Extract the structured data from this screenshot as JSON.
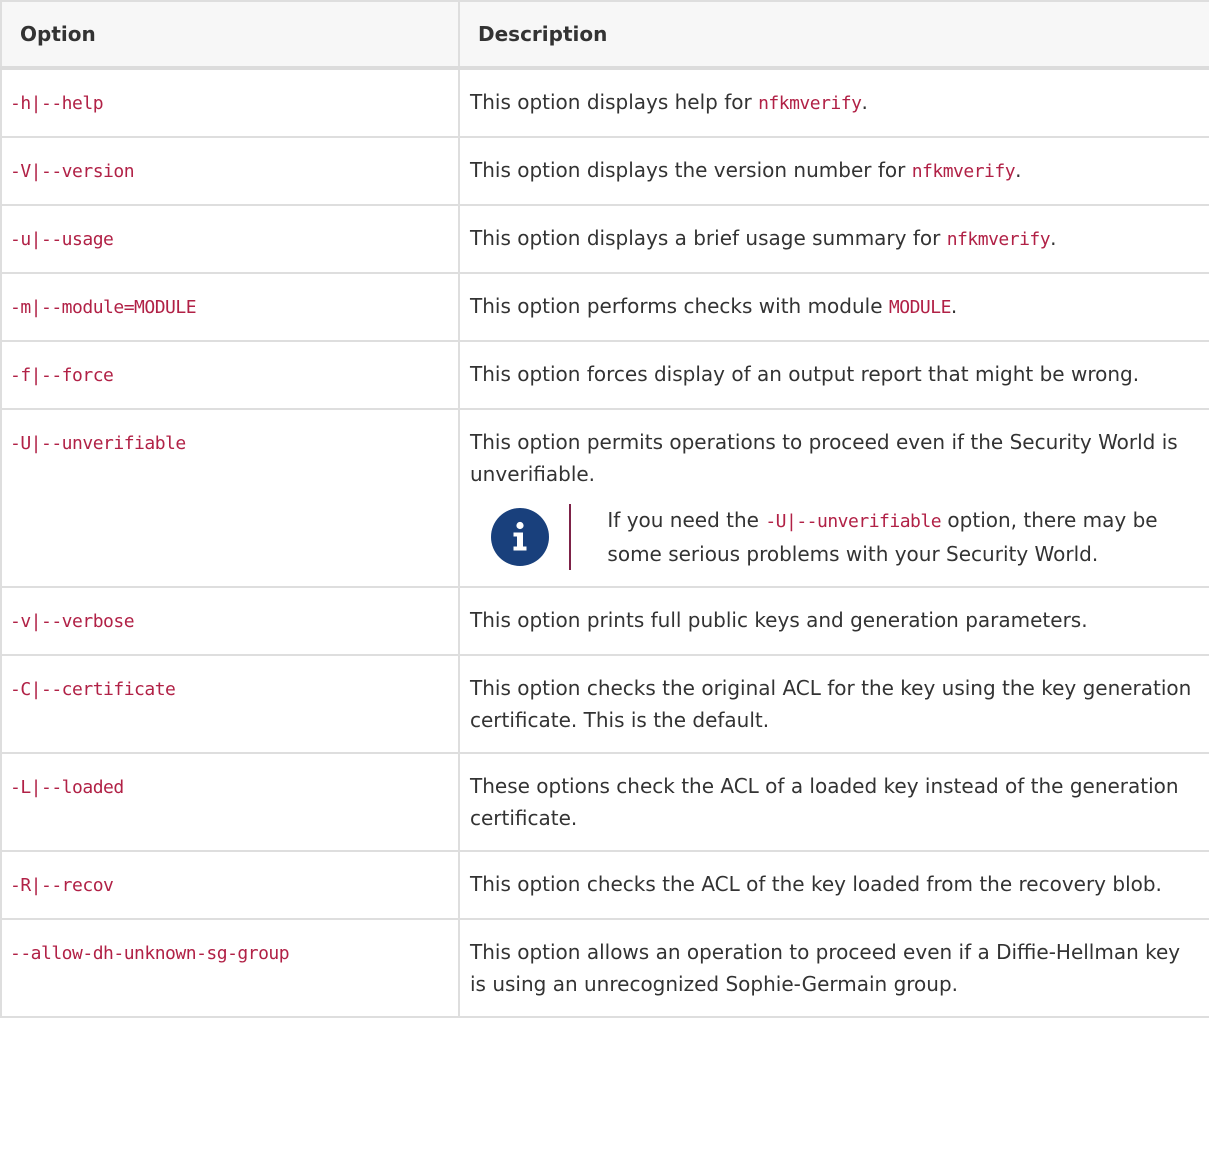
{
  "table": {
    "headers": [
      "Option",
      "Description"
    ],
    "rows": [
      {
        "option": "-h|--help",
        "pre": "This option displays help for ",
        "code": "nfkmverify",
        "post": "."
      },
      {
        "option": "-V|--version",
        "pre": "This option displays the version number for ",
        "code": "nfkmverify",
        "post": "."
      },
      {
        "option": "-u|--usage",
        "pre": "This option displays a brief usage summary for ",
        "code": "nfkmverify",
        "post": "."
      },
      {
        "option": "-m|--module=MODULE",
        "pre": "This option performs checks with module ",
        "code": "MODULE",
        "post": "."
      },
      {
        "option": "-f|--force",
        "text": "This option forces display of an output report that might be wrong."
      },
      {
        "option": "-U|--unverifiable",
        "text": "This option permits operations to proceed even if the Security World is unverifiable.",
        "note": {
          "icon": "info-icon",
          "pre": "If you need the ",
          "code": "-U|--unverifiable",
          "post": " option, there may be some serious problems with your Security World."
        }
      },
      {
        "option": "-v|--verbose",
        "text": "This option prints full public keys and generation parameters."
      },
      {
        "option": "-C|--certificate",
        "text": "This option checks the original ACL for the key using the key generation certificate. This is the default."
      },
      {
        "option": "-L|--loaded",
        "text": "These options check the ACL of a loaded key instead of the generation certificate."
      },
      {
        "option": "-R|--recov",
        "text": "This option checks the ACL of the key loaded from the recovery blob."
      },
      {
        "option": "--allow-dh-unknown-sg-group",
        "text": "This option allows an operation to proceed even if a Diffie-Hellman key is using an unrecognized Sophie-Germain group."
      }
    ]
  },
  "colors": {
    "code": "#b12146",
    "note_icon_bg": "#19407c",
    "note_rule": "#7d2248",
    "header_bg": "#f7f7f7",
    "border": "#dedede"
  }
}
